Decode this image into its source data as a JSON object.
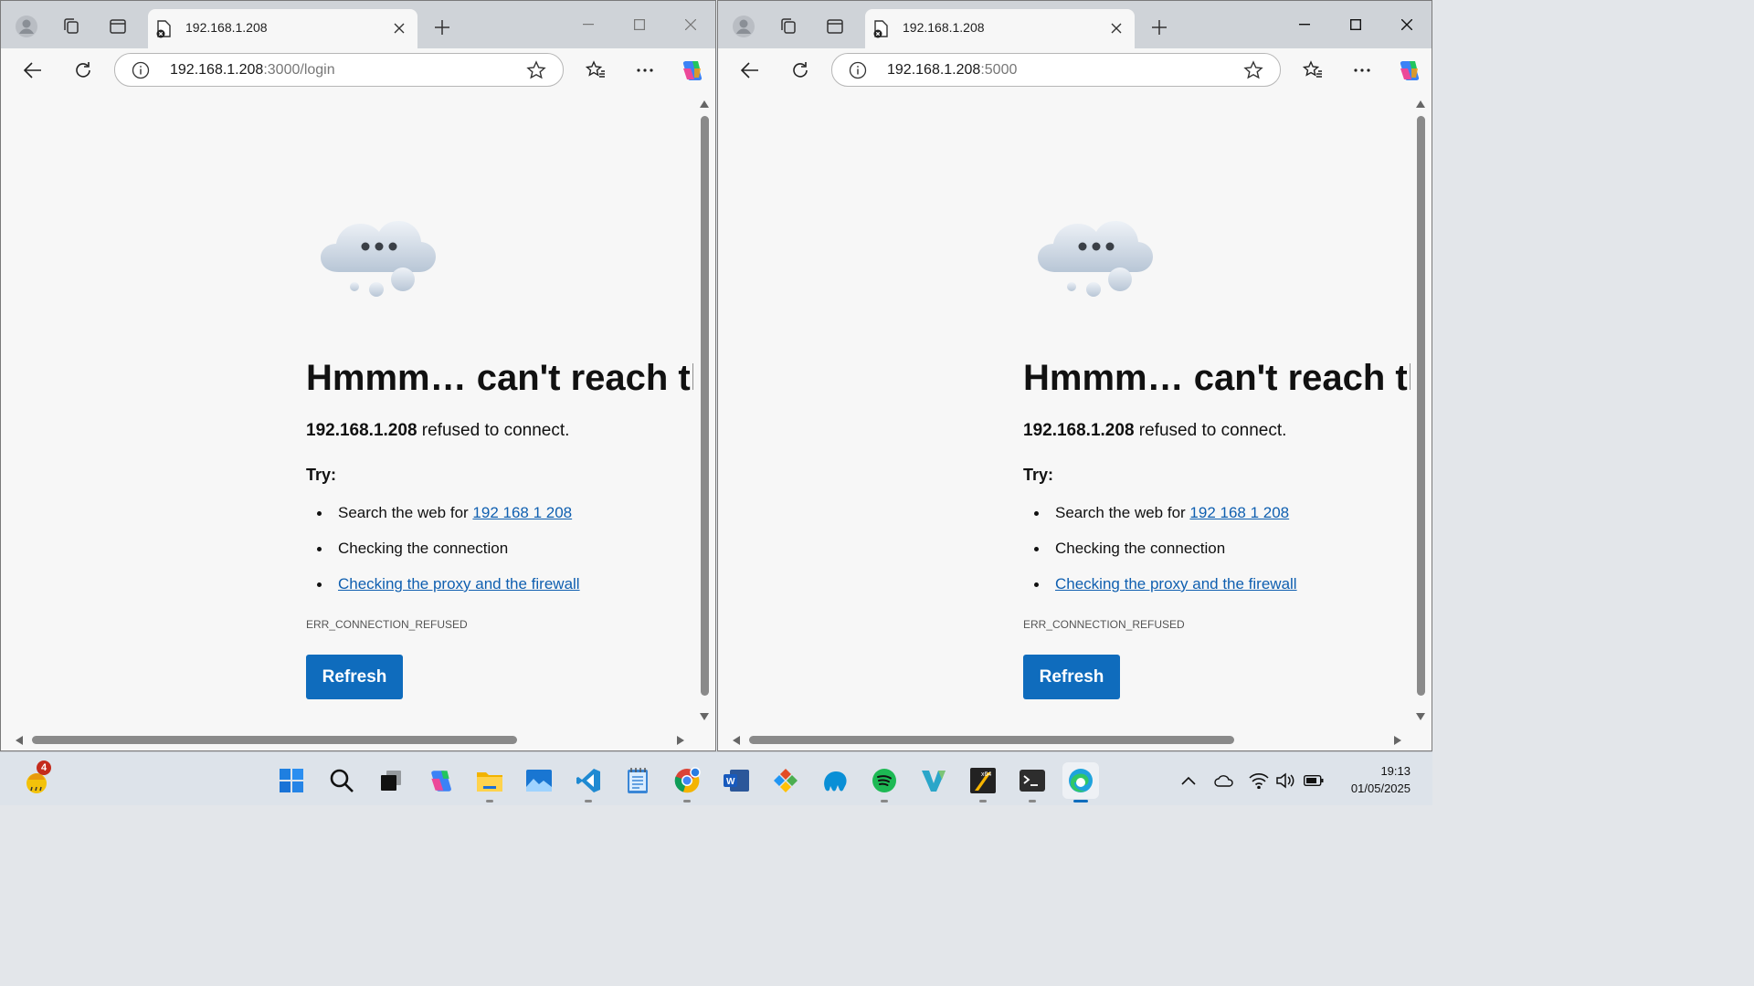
{
  "windows": [
    {
      "tab_title": "192.168.1.208",
      "url_host": "192.168.1.208",
      "url_path": ":3000/login",
      "headline": "Hmmm… can't reach thi",
      "sub_host": "192.168.1.208",
      "sub_rest": " refused to connect.",
      "try_label": "Try:",
      "suggestion_1_prefix": "Search the web for ",
      "suggestion_1_link": "192 168 1 208",
      "suggestion_2": "Checking the connection",
      "suggestion_3_link": "Checking the proxy and the firewall",
      "error_code": "ERR_CONNECTION_REFUSED",
      "refresh_label": "Refresh"
    },
    {
      "tab_title": "192.168.1.208",
      "url_host": "192.168.1.208",
      "url_path": ":5000",
      "headline": "Hmmm… can't reach thi",
      "sub_host": "192.168.1.208",
      "sub_rest": " refused to connect.",
      "try_label": "Try:",
      "suggestion_1_prefix": "Search the web for ",
      "suggestion_1_link": "192 168 1 208",
      "suggestion_2": "Checking the connection",
      "suggestion_3_link": "Checking the proxy and the firewall",
      "error_code": "ERR_CONNECTION_REFUSED",
      "refresh_label": "Refresh"
    }
  ],
  "taskbar": {
    "weather_badge": "4",
    "time": "19:13",
    "date": "01/05/2025",
    "apps": [
      "start-icon",
      "search-icon",
      "task-view-icon",
      "copilot-icon",
      "file-explorer-icon",
      "photos-icon",
      "vscode-icon",
      "notepad-icon",
      "chrome-icon",
      "word-icon",
      "git-icon",
      "mysql-workbench-icon",
      "spotify-icon",
      "visual-studio-icon",
      "xampp-icon",
      "terminal-icon",
      "edge-icon"
    ]
  },
  "colors": {
    "accent": "#0f6cbd",
    "link": "#0f5fb0",
    "titlebar": "#cfd3d8"
  }
}
